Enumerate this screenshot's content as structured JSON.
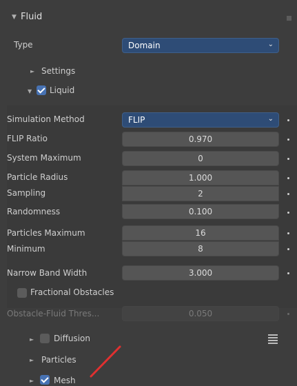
{
  "panel": {
    "title": "Fluid"
  },
  "type_row": {
    "label": "Type",
    "value": "Domain"
  },
  "sections": {
    "settings": "Settings",
    "liquid": "Liquid"
  },
  "simulation_method": {
    "label": "Simulation Method",
    "value": "FLIP"
  },
  "fields": [
    {
      "label": "FLIP Ratio",
      "value": "0.970"
    },
    {
      "label": "System Maximum",
      "value": "0"
    },
    {
      "label": "Particle Radius",
      "value": "1.000"
    },
    {
      "label": "Sampling",
      "value": "2"
    },
    {
      "label": "Randomness",
      "value": "0.100"
    },
    {
      "label": "Particles Maximum",
      "value": "16"
    },
    {
      "label": "Minimum",
      "value": "8"
    },
    {
      "label": "Narrow Band Width",
      "value": "3.000"
    }
  ],
  "fractional": {
    "label": "Fractional Obstacles",
    "checked": false
  },
  "obstacle": {
    "label": "Obstacle-Fluid Thres...",
    "value": "0.050"
  },
  "subpanels": {
    "diffusion": {
      "label": "Diffusion",
      "checked": false
    },
    "particles": {
      "label": "Particles"
    },
    "mesh": {
      "label": "Mesh",
      "checked": true
    }
  },
  "colors": {
    "accent": "#4772b3",
    "dropdown": "#2e4c76",
    "annotation": "#e03030"
  }
}
